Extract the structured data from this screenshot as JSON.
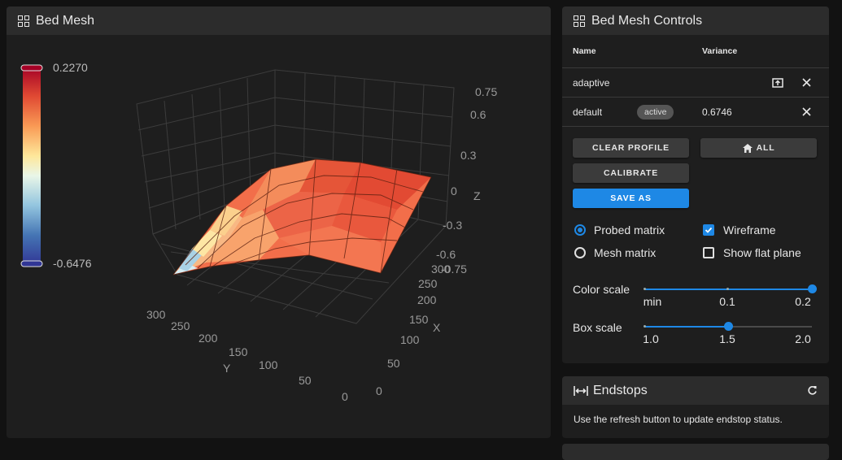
{
  "bed_mesh": {
    "title": "Bed Mesh",
    "colorbar": {
      "max": "0.2270",
      "min": "-0.6476"
    },
    "axes": {
      "z_label": "Z",
      "x_label": "X",
      "y_label": "Y",
      "z_ticks": [
        "0.75",
        "0.6",
        "0.3",
        "0",
        "-0.3",
        "-0.6",
        "-0.75"
      ],
      "x_ticks": [
        "300",
        "250",
        "200",
        "150",
        "100",
        "50",
        "0"
      ],
      "y_ticks": [
        "300",
        "250",
        "200",
        "150",
        "100",
        "50",
        "0"
      ]
    }
  },
  "controls": {
    "title": "Bed Mesh Controls",
    "columns": {
      "name": "Name",
      "variance": "Variance"
    },
    "profiles": [
      {
        "name": "adaptive",
        "variance": ""
      },
      {
        "name": "default",
        "badge": "active",
        "variance": "0.6746"
      }
    ],
    "buttons": {
      "clear_profile": "CLEAR PROFILE",
      "home_all": "ALL",
      "calibrate": "CALIBRATE",
      "save_as": "SAVE AS"
    },
    "options": {
      "probed_matrix": "Probed matrix",
      "mesh_matrix": "Mesh matrix",
      "wireframe": "Wireframe",
      "show_flat_plane": "Show flat plane",
      "probed_matrix_selected": true,
      "wireframe_checked": true,
      "flat_plane_checked": false
    },
    "color_scale": {
      "label": "Color scale",
      "ticks": [
        "min",
        "0.1",
        "0.2"
      ],
      "value": 1.0
    },
    "box_scale": {
      "label": "Box scale",
      "ticks": [
        "1.0",
        "1.5",
        "2.0"
      ],
      "value": 0.5
    }
  },
  "endstops": {
    "title": "Endstops",
    "message": "Use the refresh button to update endstop status."
  },
  "colors": {
    "accent": "#1e88e5",
    "card": "#1e1e1e",
    "header": "#2c2c2c"
  }
}
